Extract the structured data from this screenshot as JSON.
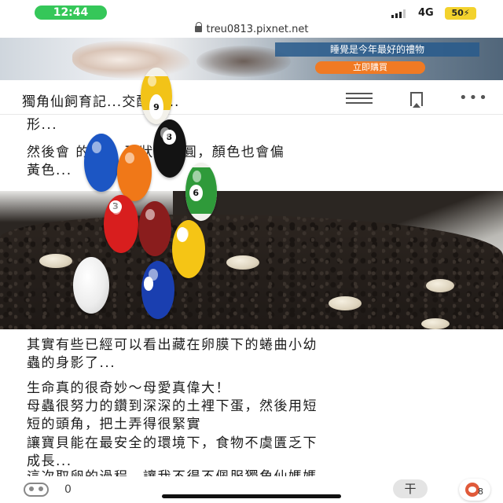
{
  "status_bar": {
    "time": "12:44",
    "network": "4G",
    "battery": "50"
  },
  "browser": {
    "url": "treu0813.pixnet.net"
  },
  "ad": {
    "headline": "睡覺是今年最好的禮物",
    "cta": "立即購買"
  },
  "header": {
    "title": "獨角仙飼育記...交配與...",
    "menu_icon": "menu-icon",
    "bookmark_icon": "bookmark-icon",
    "more_icon": "more-icon"
  },
  "article": {
    "para_top_1": "形...",
    "para_top_2a": "然後會     的   大，形狀比較圓，顏色也會偏",
    "para_top_2b": "黃色...",
    "para_1a": "其實有些已經可以看出藏在卵膜下的蜷曲小幼",
    "para_1b": "蟲的身影了...",
    "para_2a": "生命真的很奇妙～母愛真偉大！",
    "para_2b": "母蟲很努力的鑽到深深的土裡下蛋，然後用短",
    "para_2c": "短的頭角，把土弄得很緊實",
    "para_2d": "讓寶貝能在最安全的環境下，食物不虞匱乏下",
    "para_2e": "成長...",
    "para_3a": "這次取卵的過程，讓我不得不佩服獨角仙媽媽"
  },
  "overlay_balls": [
    {
      "number": "9",
      "color": "#f2c318",
      "stripe": true
    },
    {
      "number": "8",
      "color": "#111111",
      "stripe": false
    },
    {
      "number": "",
      "color": "#1c56c4",
      "stripe": false
    },
    {
      "number": "",
      "color": "#f07818",
      "stripe": false
    },
    {
      "number": "6",
      "color": "#2f9a3a",
      "stripe": true
    },
    {
      "number": "3",
      "color": "#d81e1e",
      "stripe": false
    },
    {
      "number": "",
      "color": "#8a1d1d",
      "stripe": false
    },
    {
      "number": "",
      "color": "#f5c515",
      "stripe": false
    },
    {
      "number": "",
      "color": "#1a3fb0",
      "stripe": false
    },
    {
      "number": "",
      "color": "#f4f4f4",
      "stripe": false
    }
  ],
  "bottom_bar": {
    "like_count": "0",
    "tip_icon": "tip-icon",
    "avatar_badge": "8"
  }
}
